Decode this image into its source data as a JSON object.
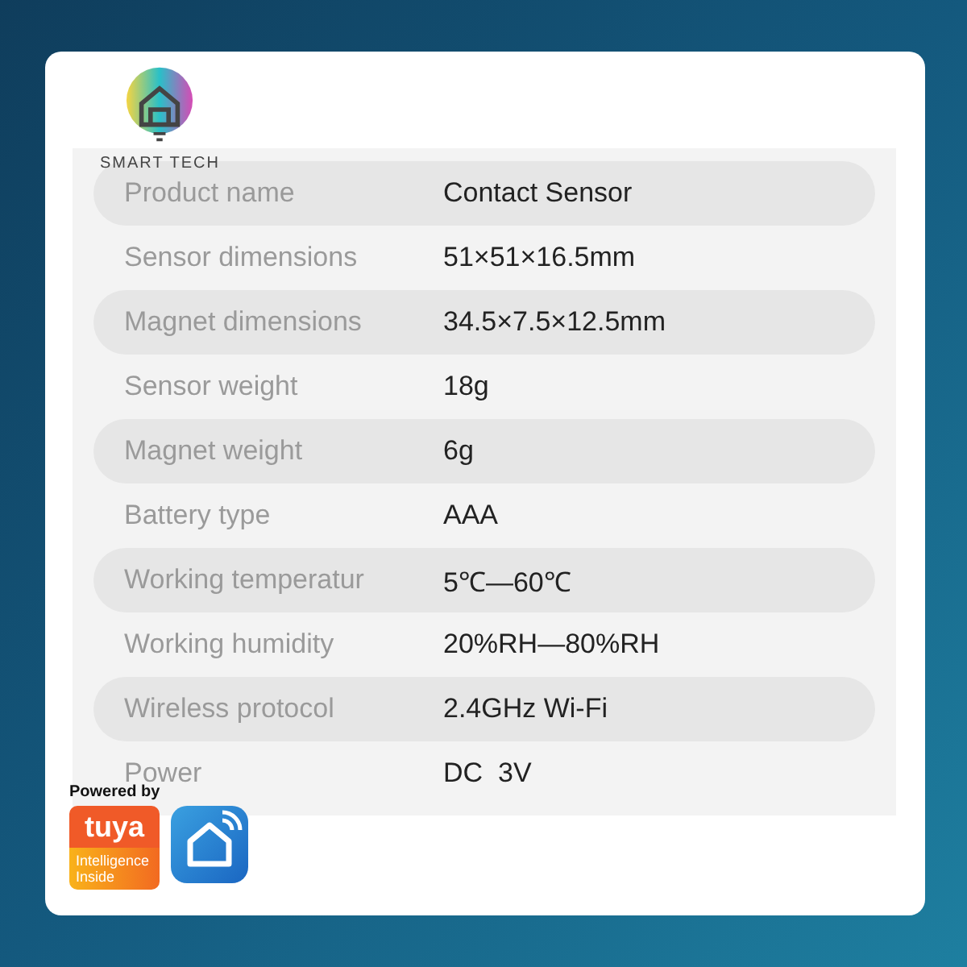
{
  "logo": {
    "text": "SMART TECH"
  },
  "specs": [
    {
      "label": "Product name",
      "value": "Contact Sensor"
    },
    {
      "label": "Sensor dimensions",
      "value": "51×51×16.5mm"
    },
    {
      "label": "Magnet dimensions",
      "value": "34.5×7.5×12.5mm"
    },
    {
      "label": "Sensor weight",
      "value": "18g"
    },
    {
      "label": "Magnet weight",
      "value": "6g"
    },
    {
      "label": "Battery type",
      "value": "AAA"
    },
    {
      "label": "Working temperatur",
      "value": "5℃—60℃"
    },
    {
      "label": "Working humidity",
      "value": "20%RH—80%RH"
    },
    {
      "label": "Wireless protocol",
      "value": "2.4GHz Wi-Fi"
    },
    {
      "label": "Power",
      "value": "DC  3V"
    }
  ],
  "badges": {
    "powered_by": "Powered by",
    "brand": "tuya",
    "tagline": "Intelligence Inside"
  }
}
